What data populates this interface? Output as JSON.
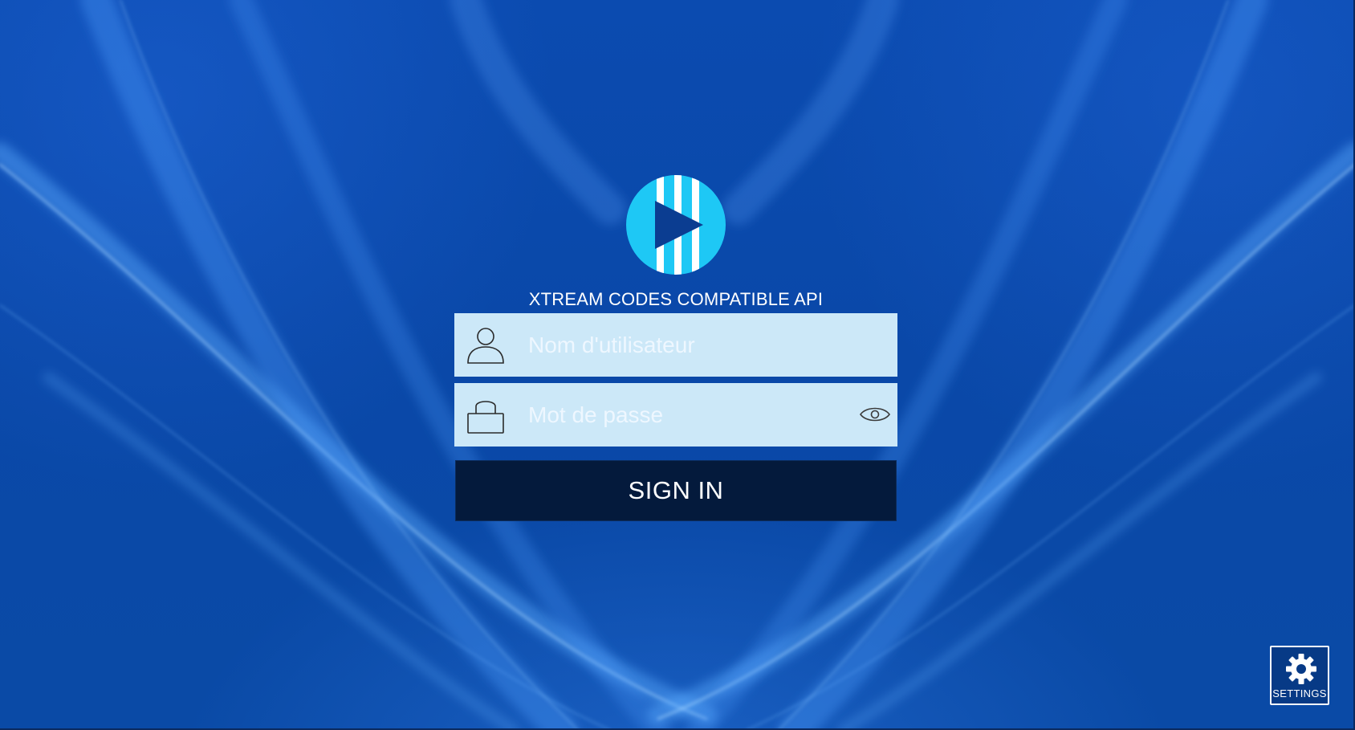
{
  "app": {
    "api_title": "XTREAM CODES COMPATIBLE API"
  },
  "login": {
    "username_placeholder": "Nom d'utilisateur",
    "username_value": "",
    "password_placeholder": "Mot de passe",
    "password_value": "",
    "signin_label": "SIGN IN"
  },
  "settings": {
    "label": "SETTINGS"
  },
  "icons": {
    "logo": "play-logo-icon",
    "username": "user-icon",
    "password": "lock-icon",
    "show_password": "eye-icon",
    "settings": "gear-icon"
  },
  "colors": {
    "background": "#0a4aa8",
    "field_background": "#cce8f8",
    "signin_background": "#041a3c",
    "logo_accent": "#1ec8f5"
  }
}
